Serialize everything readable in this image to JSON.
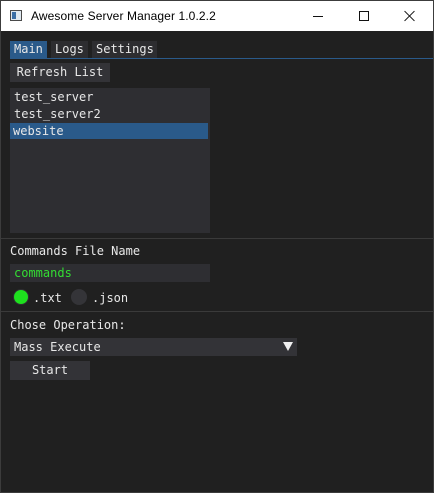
{
  "window": {
    "title": "Awesome Server Manager 1.0.2.2",
    "controls": {
      "minimize_icon": "minimize-icon",
      "maximize_icon": "maximize-icon",
      "close_icon": "close-icon"
    }
  },
  "tabs": [
    {
      "label": "Main",
      "active": true
    },
    {
      "label": "Logs",
      "active": false
    },
    {
      "label": "Settings",
      "active": false
    }
  ],
  "main": {
    "refresh_label": "Refresh List",
    "servers": [
      {
        "name": "test_server",
        "selected": false
      },
      {
        "name": "test_server2",
        "selected": false
      },
      {
        "name": "website",
        "selected": true
      }
    ],
    "commands_label": "Commands File Name",
    "commands_value": "commands",
    "format_options": [
      {
        "label": ".txt",
        "checked": true
      },
      {
        "label": ".json",
        "checked": false
      }
    ],
    "operation_label": "Chose Operation:",
    "operation_selected": "Mass Execute",
    "start_label": "Start"
  },
  "colors": {
    "accent": "#2a5a8a",
    "input_text": "#33dd33",
    "radio_checked": "#1ee01e",
    "background": "#202020"
  }
}
